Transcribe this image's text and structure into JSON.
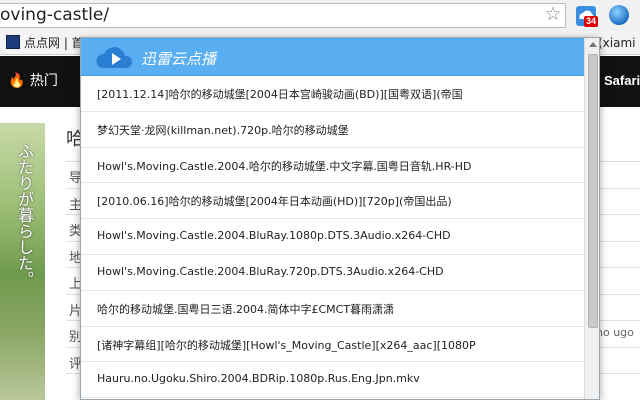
{
  "browser": {
    "address": "oving-castle/",
    "ext_badge": "34"
  },
  "bookmarks": {
    "item1": "点点网 | 首",
    "item2": "(xiami"
  },
  "site_nav": {
    "hot_label": "🔥 热门",
    "safari_label": "Safari"
  },
  "page": {
    "title": "哈",
    "poster_text": "ふたりが暮らした。",
    "info_labels": [
      "导",
      "主",
      "类",
      "地",
      "上",
      "片",
      "别",
      "评"
    ],
    "info_right_text": "no ugo"
  },
  "popup": {
    "title": "迅雷云点播",
    "items": [
      "[2011.12.14]哈尔的移动城堡[2004日本宫崎骏动画(BD)][国粤双语](帝国",
      "梦幻天堂·龙网(killman.net).720p.哈尔的移动城堡",
      "Howl's.Moving.Castle.2004.哈尔的移动城堡.中文字幕.国粤日音轨.HR-HD",
      "[2010.06.16]哈尔的移动城堡[2004年日本动画(HD)][720p](帝国出品)",
      "Howl's.Moving.Castle.2004.BluRay.1080p.DTS.3Audio.x264-CHD",
      "Howl's.Moving.Castle.2004.BluRay.720p.DTS.3Audio.x264-CHD",
      "哈尔的移动城堡.国粤日三语.2004.简体中字£CMCT暮雨潇潇",
      "[诸神字幕组][哈尔的移动城堡][Howl's_Moving_Castle][x264_aac][1080P",
      "Hauru.no.Ugoku.Shiro.2004.BDRip.1080p.Rus.Eng.Jpn.mkv"
    ]
  },
  "colors": {
    "popup_header": "#58aef0",
    "nav_bg": "#111111"
  }
}
